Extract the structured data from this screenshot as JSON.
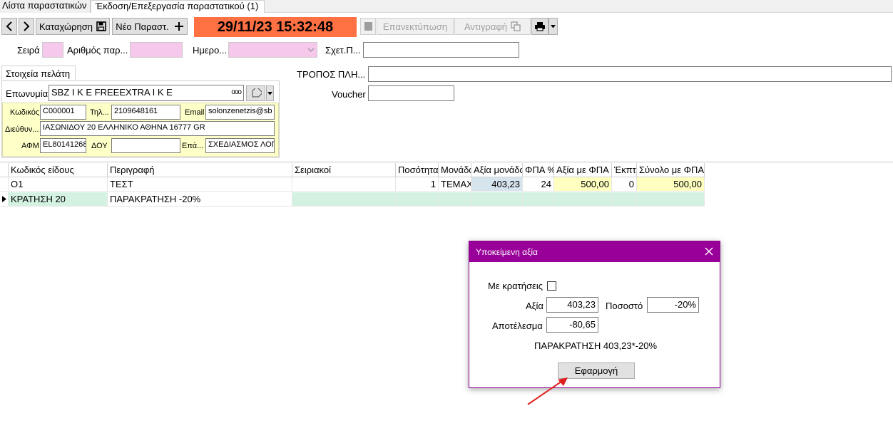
{
  "tabs": {
    "list": "Λίστα παραστατικών",
    "edit": "Έκδοση/Επεξεργασία παραστατικού (1)"
  },
  "toolbar": {
    "prev_icon": "chevron-left-icon",
    "next_icon": "chevron-right-icon",
    "save_label": "Καταχώρηση",
    "new_label": "Νέο Παραστ.",
    "datetime": "29/11/23 15:32:48",
    "reprint_label": "Επανεκτύπωση",
    "copy_label": "Αντιγραφή",
    "accent_datetime": "#ff7043"
  },
  "header_fields": {
    "series_label": "Σειρά",
    "number_label": "Αριθμός παρ...",
    "date_label": "Ημερο...",
    "related_label": "Σχετ.Π...",
    "payment_label": "ΤΡΟΠΟΣ ΠΛΗ...",
    "voucher_label": "Voucher"
  },
  "customer": {
    "tab_label": "Στοιχεία πελάτη",
    "name_label": "Επωνυμία",
    "name_value": "SBZ I K E  FREEEXTRA I K E",
    "code_label": "Κωδικός",
    "code_value": "C000001",
    "phone_label": "Τηλ...",
    "phone_value": "2109648161",
    "email_label": "Email",
    "email_value": "solonzenetzis@sb",
    "address_label": "Διεύθυν...",
    "address_value": "ΙΑΣΩΝΙΔΟΥ 20 ΕΛΛΗΝΙΚΟ ΑΘΗΝΑ 16777 GR",
    "afm_label": "ΑΦΜ",
    "afm_value": "EL80141268",
    "doy_label": "ΔΟΥ",
    "doy_value": "",
    "prof_label": "Επά...",
    "prof_value": "ΣΧΕΔΙΑΣΜΟΣ ΛΟΓ"
  },
  "grid": {
    "headers": [
      "Κωδικός είδους",
      "Περιγραφή",
      "Σειριακοί",
      "Ποσότητα",
      "Μονάδα",
      "Αξία μονάδας",
      "ΦΠΑ %",
      "Αξία με ΦΠΑ",
      "Έκπτ",
      "Σύνολο με ΦΠΑ"
    ],
    "rows": [
      [
        "O1",
        "ΤΕΣΤ",
        "",
        "1",
        "ΤΕΜΑΧ",
        "403,23",
        "24",
        "500,00",
        "0",
        "500,00"
      ],
      [
        "ΚΡΑΤΗΣΗ 20",
        "ΠΑΡΑΚΡΑΤΗΣΗ -20%",
        "",
        "",
        "",
        "",
        "",
        "",
        "",
        ""
      ]
    ]
  },
  "dialog": {
    "title": "Υποκείμενη αξία",
    "with_deductions_label": "Με κρατήσεις",
    "with_deductions_checked": false,
    "value_label": "Αξία",
    "value": "403,23",
    "percent_label": "Ποσοστό",
    "percent": "-20%",
    "result_label": "Αποτέλεσμα",
    "result": "-80,65",
    "formula": "ΠΑΡΑΚΡΑΤΗΣΗ 403,23*-20%",
    "apply_label": "Εφαρμογή"
  }
}
